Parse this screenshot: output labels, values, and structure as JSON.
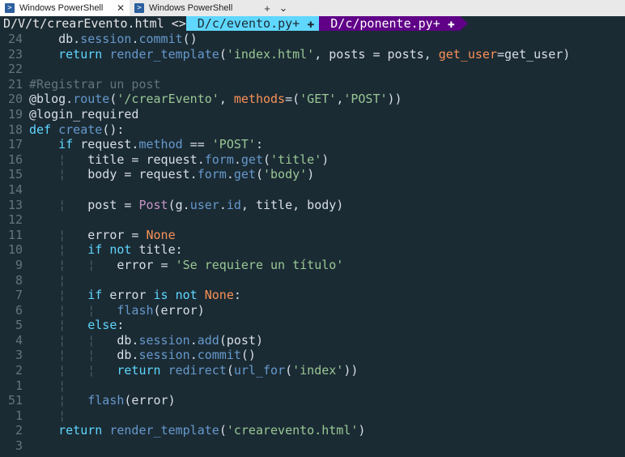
{
  "window": {
    "tabs": [
      {
        "title": "Windows PowerShell",
        "active": true
      },
      {
        "title": "Windows PowerShell",
        "active": false
      }
    ],
    "new_tab": "+",
    "dropdown": "⌄",
    "close": "✕",
    "icon": "powershell-icon"
  },
  "vim_tabs": [
    {
      "label": "D/V/t/crearEvento.html",
      "marker": "<>"
    },
    {
      "label": "D/c/evento.py+",
      "marker": "✚"
    },
    {
      "label": "D/c/ponente.py+",
      "marker": "✚"
    }
  ],
  "lines": [
    {
      "num": "24",
      "text": "    db.session.commit()"
    },
    {
      "num": "23",
      "text": "    return render_template('index.html', posts = posts, get_user=get_user)"
    },
    {
      "num": "22",
      "text": ""
    },
    {
      "num": "21",
      "text": "#Registrar un post"
    },
    {
      "num": "20",
      "text": "@blog.route('/crearEvento', methods=('GET','POST'))"
    },
    {
      "num": "19",
      "text": "@login_required"
    },
    {
      "num": "18",
      "text": "def create():"
    },
    {
      "num": "17",
      "text": "    if request.method == 'POST':"
    },
    {
      "num": "16",
      "text": "    ¦   title = request.form.get('title')"
    },
    {
      "num": "15",
      "text": "    ¦   body = request.form.get('body')"
    },
    {
      "num": "14",
      "text": ""
    },
    {
      "num": "13",
      "text": "    ¦   post = Post(g.user.id, title, body)"
    },
    {
      "num": "12",
      "text": ""
    },
    {
      "num": "11",
      "text": "    ¦   error = None"
    },
    {
      "num": "10",
      "text": "    ¦   if not title:"
    },
    {
      "num": "9",
      "text": "    ¦   ¦   error = 'Se requiere un título'"
    },
    {
      "num": "8",
      "text": "    ¦"
    },
    {
      "num": "7",
      "text": "    ¦   if error is not None:"
    },
    {
      "num": "6",
      "text": "    ¦   ¦   flash(error)"
    },
    {
      "num": "5",
      "text": "    ¦   else:"
    },
    {
      "num": "4",
      "text": "    ¦   ¦   db.session.add(post)"
    },
    {
      "num": "3",
      "text": "    ¦   ¦   db.session.commit()"
    },
    {
      "num": "2",
      "text": "    ¦   ¦   return redirect(url_for('index'))"
    },
    {
      "num": "1",
      "text": "    ¦"
    },
    {
      "num": "51",
      "text": "    ¦   flash(error)"
    },
    {
      "num": "1",
      "text": "    ¦"
    },
    {
      "num": "2",
      "text": "    return render_template('crearevento.html')"
    },
    {
      "num": "3",
      "text": ""
    }
  ],
  "colors": {
    "background": "#1b2b34",
    "keyword": "#5fd7ff",
    "string": "#99c794",
    "comment": "#65737e",
    "tab_cyan": "#5fd7ff",
    "tab_purple": "#5f0087"
  }
}
